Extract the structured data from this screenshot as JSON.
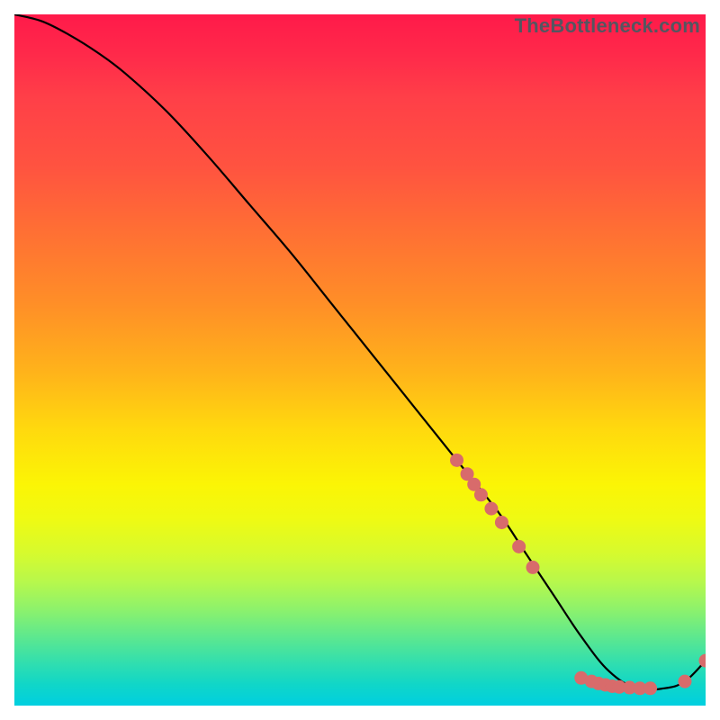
{
  "watermark": "TheBottleneck.com",
  "chart_data": {
    "type": "line",
    "title": "",
    "xlabel": "",
    "ylabel": "",
    "xlim": [
      0,
      100
    ],
    "ylim": [
      0,
      100
    ],
    "grid": false,
    "legend": false,
    "series": [
      {
        "name": "curve",
        "color": "#000000",
        "x": [
          0,
          4,
          8,
          12,
          16,
          22,
          28,
          34,
          40,
          46,
          52,
          58,
          64,
          70,
          74,
          78,
          82,
          86,
          90,
          94,
          97,
          100
        ],
        "y": [
          100,
          99,
          97,
          94.5,
          91.5,
          86,
          79.5,
          72.5,
          65.5,
          58,
          50.5,
          43,
          35.5,
          28,
          22,
          16,
          10,
          5,
          2.5,
          2.5,
          3.5,
          6.5
        ]
      }
    ],
    "markers": [
      {
        "group": "upper-cluster",
        "color": "#d86b6b",
        "points": [
          {
            "x": 64.0,
            "y": 35.5
          },
          {
            "x": 65.5,
            "y": 33.5
          },
          {
            "x": 66.5,
            "y": 32.0
          },
          {
            "x": 67.5,
            "y": 30.5
          },
          {
            "x": 69.0,
            "y": 28.5
          },
          {
            "x": 70.5,
            "y": 26.5
          },
          {
            "x": 73.0,
            "y": 23.0
          },
          {
            "x": 75.0,
            "y": 20.0
          }
        ]
      },
      {
        "group": "lower-cluster",
        "color": "#d86b6b",
        "points": [
          {
            "x": 82.0,
            "y": 4.0
          },
          {
            "x": 83.5,
            "y": 3.5
          },
          {
            "x": 84.5,
            "y": 3.2
          },
          {
            "x": 85.5,
            "y": 3.0
          },
          {
            "x": 86.5,
            "y": 2.8
          },
          {
            "x": 87.5,
            "y": 2.7
          },
          {
            "x": 89.0,
            "y": 2.6
          },
          {
            "x": 90.5,
            "y": 2.5
          },
          {
            "x": 92.0,
            "y": 2.5
          }
        ]
      },
      {
        "group": "tail",
        "color": "#d86b6b",
        "points": [
          {
            "x": 97.0,
            "y": 3.5
          },
          {
            "x": 100.0,
            "y": 6.5
          }
        ]
      }
    ]
  }
}
